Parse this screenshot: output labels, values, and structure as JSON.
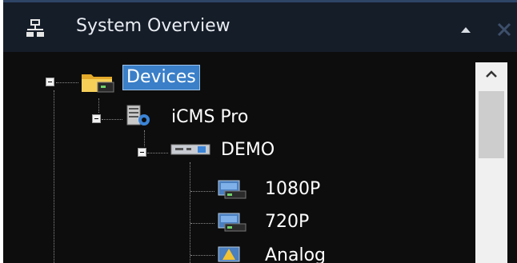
{
  "panel": {
    "title": "System Overview",
    "icon": "network-icon",
    "collapse_icon": "collapse-up-icon",
    "close_icon": "close-icon"
  },
  "tree": {
    "root": {
      "label": "Devices",
      "icon": "folder-camera-icon",
      "selected": true
    },
    "server": {
      "label": "iCMS Pro",
      "icon": "server-gear-icon"
    },
    "device": {
      "label": "DEMO",
      "icon": "dvr-device-icon"
    },
    "channels": [
      {
        "label": "1080P",
        "icon": "camera-icon"
      },
      {
        "label": "720P",
        "icon": "camera-icon"
      },
      {
        "label": "Analog",
        "icon": "camera-warning-icon"
      }
    ]
  },
  "colors": {
    "header_bg": "#151d29",
    "tree_bg": "#0d0d0d",
    "selection": "#3a7fc8",
    "text": "#ffffff"
  }
}
